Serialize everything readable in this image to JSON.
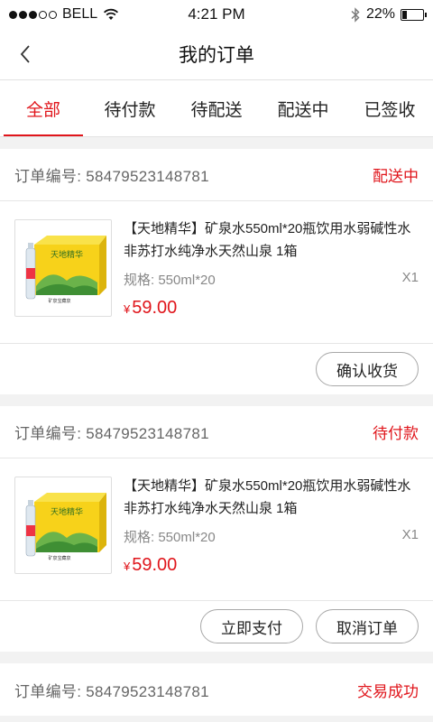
{
  "status_bar": {
    "carrier": "BELL",
    "time": "4:21 PM",
    "battery": "22%",
    "battery_level": 0.22
  },
  "nav": {
    "title": "我的订单"
  },
  "tabs": [
    {
      "label": "全部",
      "active": true
    },
    {
      "label": "待付款",
      "active": false
    },
    {
      "label": "待配送",
      "active": false
    },
    {
      "label": "配送中",
      "active": false
    },
    {
      "label": "已签收",
      "active": false
    }
  ],
  "orders": [
    {
      "number_label": "订单编号:",
      "number": "58479523148781",
      "status": "配送中",
      "product": {
        "name": "【天地精华】矿泉水550ml*20瓶饮用水弱碱性水非苏打水纯净水天然山泉 1箱",
        "spec_label": "规格:",
        "spec": "550ml*20",
        "qty": "X1",
        "currency": "¥",
        "price": "59.00",
        "image_brand": "天地精华",
        "image_tag": "矿泉宝藏泉"
      },
      "buttons": [
        "确认收货"
      ]
    },
    {
      "number_label": "订单编号:",
      "number": "58479523148781",
      "status": "待付款",
      "product": {
        "name": "【天地精华】矿泉水550ml*20瓶饮用水弱碱性水非苏打水纯净水天然山泉 1箱",
        "spec_label": "规格:",
        "spec": "550ml*20",
        "qty": "X1",
        "currency": "¥",
        "price": "59.00",
        "image_brand": "天地精华",
        "image_tag": "矿泉宝藏泉"
      },
      "buttons": [
        "立即支付",
        "取消订单"
      ]
    },
    {
      "number_label": "订单编号:",
      "number": "58479523148781",
      "status": "交易成功"
    }
  ],
  "colors": {
    "accent": "#e0151b",
    "background": "#f2f2f2",
    "box_yellow": "#f7d21a"
  }
}
